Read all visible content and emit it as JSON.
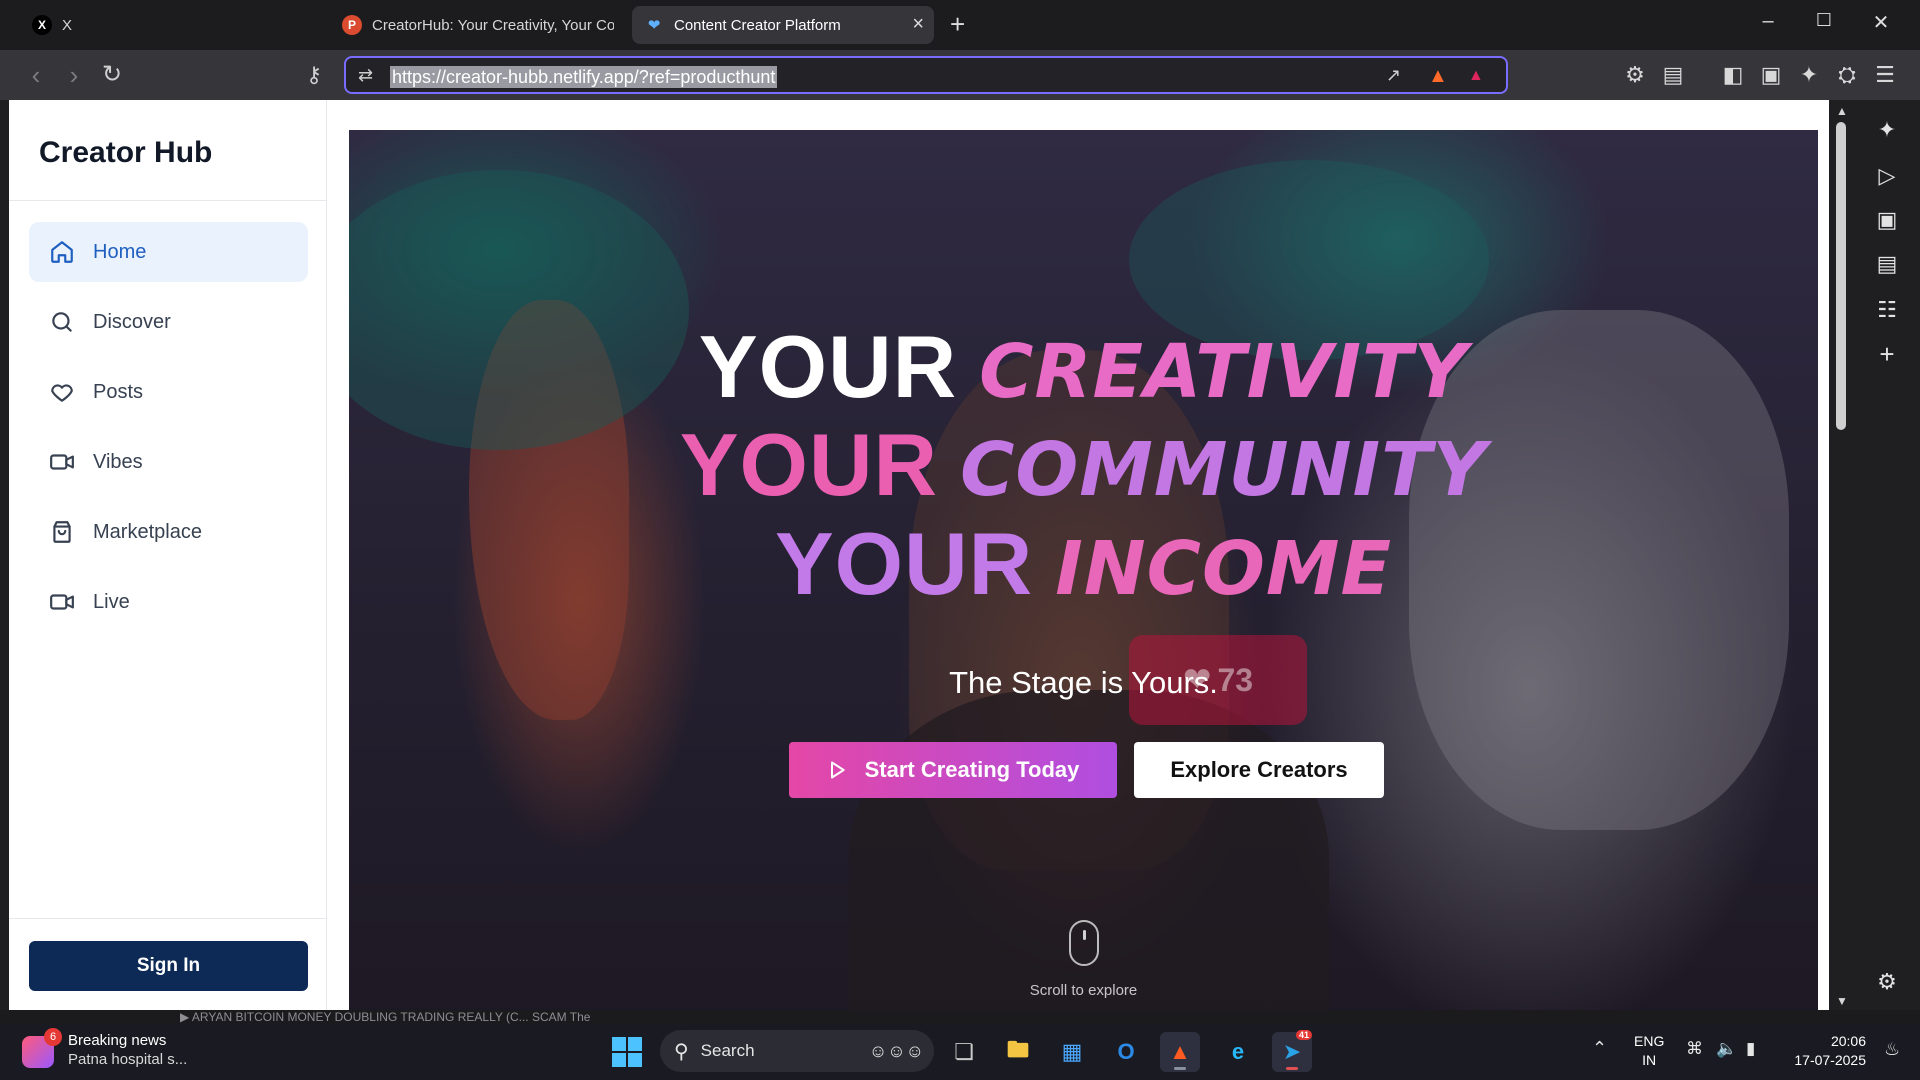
{
  "browser": {
    "tabs": [
      {
        "title": "X",
        "favicon": "x-logo-icon",
        "active": false
      },
      {
        "title": "CreatorHub: Your Creativity, Your Com",
        "favicon": "producthunt-logo-icon",
        "active": false
      },
      {
        "title": "Content Creator Platform",
        "favicon": "heart-icon",
        "active": true
      }
    ],
    "url": "https://creator-hubb.netlify.app/?ref=producthunt"
  },
  "sidebar": {
    "brand": "Creator Hub",
    "items": [
      {
        "label": "Home",
        "icon": "home-icon",
        "active": true
      },
      {
        "label": "Discover",
        "icon": "search-icon",
        "active": false
      },
      {
        "label": "Posts",
        "icon": "heart-icon",
        "active": false
      },
      {
        "label": "Vibes",
        "icon": "video-icon",
        "active": false
      },
      {
        "label": "Marketplace",
        "icon": "shopping-bag-icon",
        "active": false
      },
      {
        "label": "Live",
        "icon": "video-icon",
        "active": false
      }
    ],
    "sign_in": "Sign In"
  },
  "hero": {
    "lines": [
      {
        "word": "YOUR",
        "script": "CREATIVITY"
      },
      {
        "word": "YOUR",
        "script": "COMMUNITY"
      },
      {
        "word": "YOUR",
        "script": "INCOME"
      }
    ],
    "tagline": "The Stage is Yours.",
    "like_count": "73",
    "start_button": "Start Creating Today",
    "explore_button": "Explore Creators",
    "scroll_hint": "Scroll to explore"
  },
  "news_strip": "▶ ARYAN BITCOIN MONEY DOUBLING TRADING REALLY (C... SCAM   The",
  "taskbar": {
    "news_title": "Breaking news",
    "news_sub": "Patna hospital s...",
    "news_badge": "6",
    "search_placeholder": "Search",
    "telegram_badge": "41",
    "lang_line1": "ENG",
    "lang_line2": "IN",
    "time": "20:06",
    "date": "17-07-2025"
  },
  "colors": {
    "accent_pink": "#e447a6",
    "accent_purple": "#b04ee0",
    "brand_navy": "#0c2a55",
    "active_nav_bg": "#eaf3fd",
    "active_nav_text": "#1f5fbf"
  }
}
